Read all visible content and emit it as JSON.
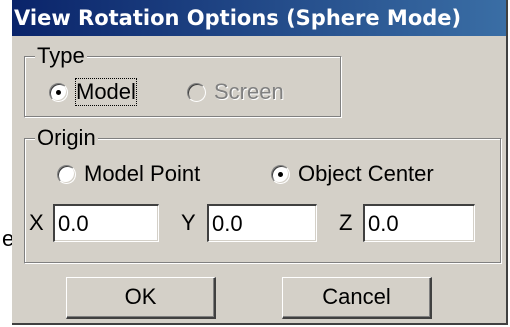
{
  "stray_text": "e",
  "dialog": {
    "title": "View Rotation Options (Sphere Mode)"
  },
  "type_group": {
    "label": "Type",
    "options": [
      {
        "label": "Model",
        "selected": true,
        "enabled": true
      },
      {
        "label": "Screen",
        "selected": false,
        "enabled": false
      }
    ]
  },
  "origin_group": {
    "label": "Origin",
    "options": [
      {
        "label": "Model Point",
        "selected": false,
        "enabled": true
      },
      {
        "label": "Object Center",
        "selected": true,
        "enabled": true
      }
    ],
    "fields": [
      {
        "axis": "X",
        "value": "0.0"
      },
      {
        "axis": "Y",
        "value": "0.0"
      },
      {
        "axis": "Z",
        "value": "0.0"
      }
    ]
  },
  "buttons": {
    "ok_label": "OK",
    "cancel_label": "Cancel"
  },
  "colors": {
    "dialog_face": "#d4d0c8",
    "title_start": "#0a246a",
    "title_end": "#3a6ea5",
    "title_text": "#ffffff",
    "disabled_text": "#808080"
  }
}
